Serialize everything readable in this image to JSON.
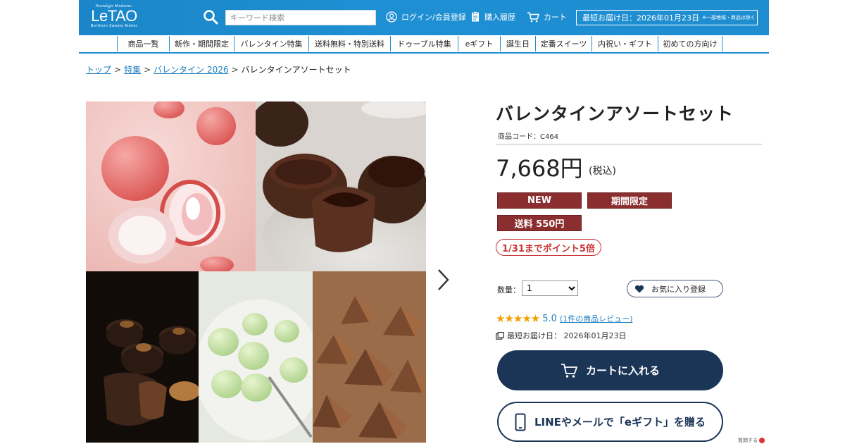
{
  "header": {
    "logo": {
      "tagline": "Nostalgie Moderne.",
      "name": "LeTAO",
      "subtitle": "Northern Sweets Atelier"
    },
    "search": {
      "placeholder": "キーワード検索"
    },
    "links": {
      "login": "ログイン/会員登録",
      "history": "購入履歴",
      "cart": "カート"
    },
    "delivery_notice": {
      "text": "最短お届け日：2026年01月23日",
      "note": "※一部地域・商品は除く"
    }
  },
  "nav": {
    "items": [
      "商品一覧",
      "新作・期間限定",
      "バレンタイン特集",
      "送料無料・特別送料",
      "ドゥーブル特集",
      "eギフト",
      "誕生日",
      "定番スイーツ",
      "内祝い・ギフト",
      "初めての方向け"
    ]
  },
  "breadcrumb": {
    "items": [
      "トップ",
      "特集",
      "バレンタイン 2026"
    ],
    "current": "バレンタインアソートセット"
  },
  "gallery": {
    "images": [
      {
        "icon": "strawberry-chocolate-image",
        "color": "#f2c6c3"
      },
      {
        "icon": "chocolate-tart-image",
        "color": "#4a2a1e"
      },
      {
        "icon": "nut-chocolate-image",
        "color": "#1a120d"
      },
      {
        "icon": "matcha-truffle-image",
        "color": "#dfe6d2"
      },
      {
        "icon": "pyramid-chocolate-image",
        "color": "#8a5a3a"
      }
    ]
  },
  "product": {
    "title": "バレンタインアソートセット",
    "code": "商品コード：C464",
    "price": "7,668円",
    "tax": "(税込)",
    "badges": [
      "NEW",
      "期間限定",
      "送料 550円"
    ],
    "point_campaign": "1/31までポイント5倍",
    "quantity_label": "数量：",
    "quantity_value": "1",
    "favorite_label": "お気に入り登録",
    "rating_stars": "★★★★★",
    "rating_value": "5.0",
    "review_link": "(1件の商品レビュー)",
    "delivery_info": "最短お届け日：  2026年01月23日",
    "cart_button": "カートに入れる",
    "gift_button": "LINEやメールで「eギフト」を贈る",
    "corner_text": "質問する"
  },
  "colors": {
    "brand_blue": "#1f8ed1",
    "badge_red": "#8b2e2f",
    "navy": "#1b3557",
    "point_red": "#cc3333",
    "star": "#f2a000"
  }
}
